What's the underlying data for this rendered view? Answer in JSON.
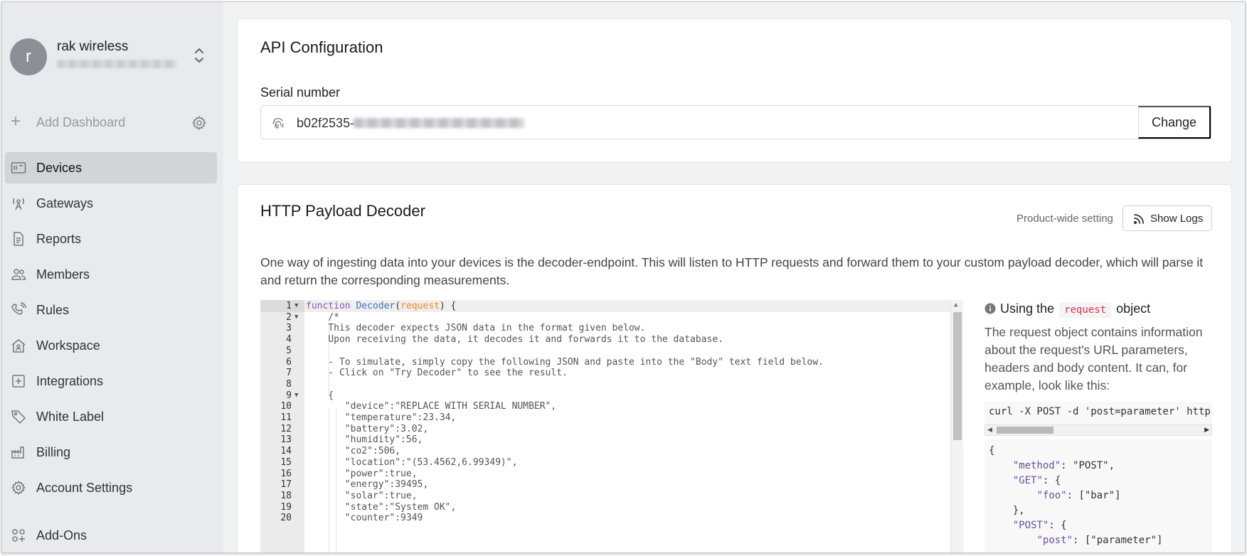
{
  "account": {
    "initial": "r",
    "name": "rak wireless"
  },
  "sidebar": {
    "add_dashboard": "Add Dashboard",
    "items": [
      {
        "label": "Devices",
        "icon": "devices-icon",
        "active": true
      },
      {
        "label": "Gateways",
        "icon": "gateway-icon"
      },
      {
        "label": "Reports",
        "icon": "report-icon"
      },
      {
        "label": "Members",
        "icon": "members-icon"
      },
      {
        "label": "Rules",
        "icon": "rules-icon"
      },
      {
        "label": "Workspace",
        "icon": "workspace-icon"
      },
      {
        "label": "Integrations",
        "icon": "integrations-icon"
      },
      {
        "label": "White Label",
        "icon": "tag-icon"
      },
      {
        "label": "Billing",
        "icon": "billing-icon"
      },
      {
        "label": "Account Settings",
        "icon": "gear-icon"
      }
    ],
    "addons": "Add-Ons"
  },
  "api_config": {
    "title": "API Configuration",
    "serial_label": "Serial number",
    "serial_value": "b02f2535-",
    "change_label": "Change"
  },
  "decoder": {
    "title": "HTTP Payload Decoder",
    "setting_label": "Product-wide setting",
    "show_logs_label": "Show Logs",
    "description": "One way of ingesting data into your devices is the decoder-endpoint. This will listen to HTTP requests and forward them to your custom payload decoder, which will parse it and return the corresponding measurements.",
    "code_lines": [
      {
        "n": "1",
        "fold": true
      },
      {
        "n": "2",
        "fold": true,
        "text": "    /*"
      },
      {
        "n": "3",
        "text": "    This decoder expects JSON data in the format given below."
      },
      {
        "n": "4",
        "text": "    Upon receiving the data, it decodes it and forwards it to the database."
      },
      {
        "n": "5",
        "text": ""
      },
      {
        "n": "6",
        "text": "    - To simulate, simply copy the following JSON and paste into the \"Body\" text field below."
      },
      {
        "n": "7",
        "text": "    - Click on \"Try Decoder\" to see the result."
      },
      {
        "n": "8",
        "text": ""
      },
      {
        "n": "9",
        "fold": true,
        "text": "    {"
      },
      {
        "n": "10",
        "text": "       \"device\":\"REPLACE WITH SERIAL NUMBER\","
      },
      {
        "n": "11",
        "text": "       \"temperature\":23.34,"
      },
      {
        "n": "12",
        "text": "       \"battery\":3.02,"
      },
      {
        "n": "13",
        "text": "       \"humidity\":56,"
      },
      {
        "n": "14",
        "text": "       \"co2\":506,"
      },
      {
        "n": "15",
        "text": "       \"location\":\"(53.4562,6.99349)\","
      },
      {
        "n": "16",
        "text": "       \"power\":true,"
      },
      {
        "n": "17",
        "text": "       \"energy\":39495,"
      },
      {
        "n": "18",
        "text": "       \"solar\":true,"
      },
      {
        "n": "19",
        "text": "       \"state\":\"System OK\","
      },
      {
        "n": "20",
        "text": "       \"counter\":9349"
      }
    ],
    "line1": {
      "kw": "function",
      "fn": "Decoder",
      "param": "request",
      "open": "(",
      "close": ") {"
    }
  },
  "info": {
    "title_pre": "Using the",
    "title_code": "request",
    "title_post": "object",
    "text": "The request object contains information about the request's URL parameters, headers and body content. It can, for example, look like this:",
    "curl": "curl -X POST -d 'post=parameter' http",
    "json_lines": [
      {
        "pre": "{"
      },
      {
        "pre": "    ",
        "key": "\"method\"",
        "rest": ": \"POST\","
      },
      {
        "pre": "    ",
        "key": "\"GET\"",
        "rest": ": {"
      },
      {
        "pre": "        ",
        "key": "\"foo\"",
        "rest": ": [\"bar\"]"
      },
      {
        "pre": "    },"
      },
      {
        "pre": "    ",
        "key": "\"POST\"",
        "rest": ": {"
      },
      {
        "pre": "        ",
        "key": "\"post\"",
        "rest": ": [\"parameter\"]"
      }
    ]
  }
}
